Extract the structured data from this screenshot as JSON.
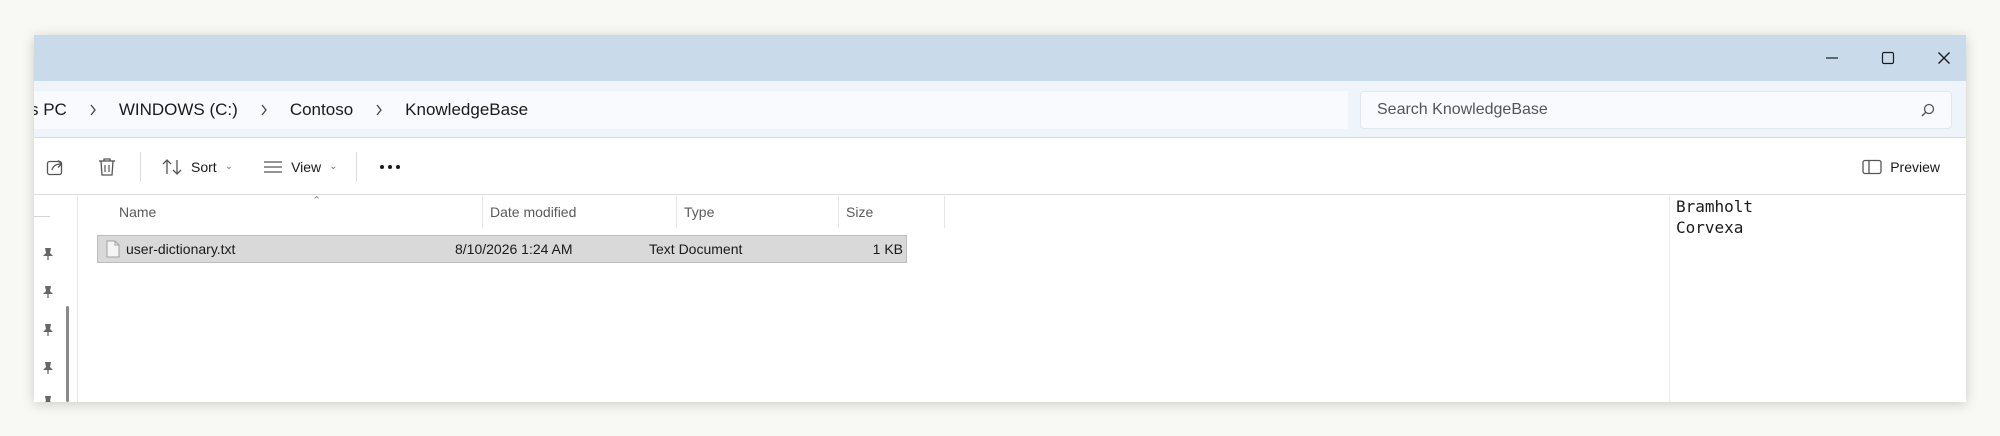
{
  "window": {
    "controls": {
      "minimize": "minimize-icon",
      "maximize": "maximize-icon",
      "close": "close-icon"
    }
  },
  "breadcrumb": {
    "items": [
      {
        "label": "s PC"
      },
      {
        "label": "WINDOWS (C:)"
      },
      {
        "label": "Contoso"
      },
      {
        "label": "KnowledgeBase"
      }
    ]
  },
  "search": {
    "placeholder": "Search KnowledgeBase",
    "icon": "search-icon"
  },
  "toolbar": {
    "share_icon": "share-icon",
    "delete_icon": "delete-icon",
    "sort_label": "Sort",
    "view_label": "View",
    "more_icon": "more-icon",
    "preview_label": "Preview"
  },
  "columns": {
    "name": "Name",
    "date": "Date modified",
    "type": "Type",
    "size": "Size"
  },
  "files": [
    {
      "name": "user-dictionary.txt",
      "date": "8/10/2026 1:24 AM",
      "type": "Text Document",
      "size": "1 KB"
    }
  ],
  "preview": {
    "content": "Bramholt\nCorvexa"
  },
  "colors": {
    "titlebar": "#c9dbeb",
    "address_row": "#eef4fa",
    "selection": "#d9d9d9"
  }
}
